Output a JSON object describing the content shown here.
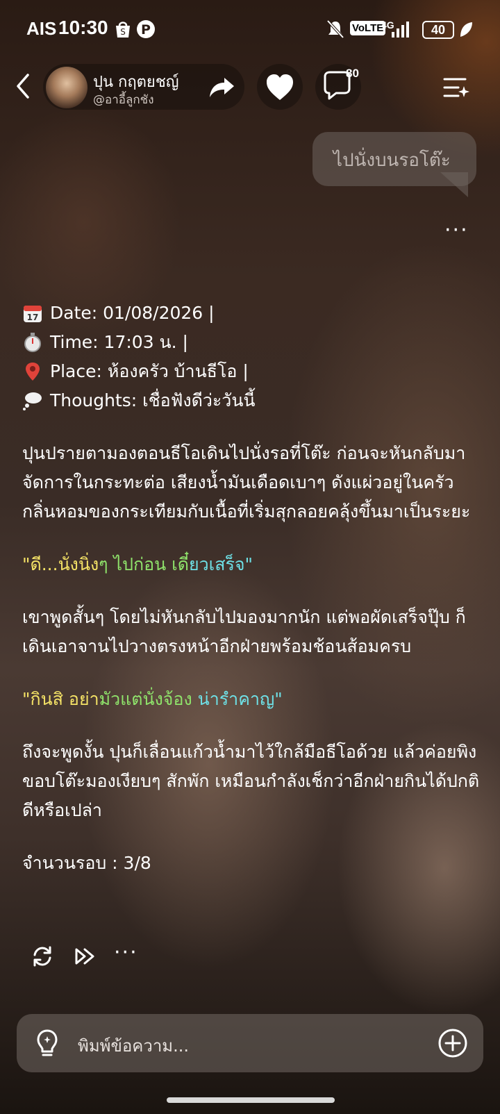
{
  "status_bar": {
    "carrier": "AIS",
    "time": "10:30",
    "volte": "VoLTE",
    "network": "4G",
    "battery": "40"
  },
  "header": {
    "character_name": "ปุน กฤตยชญ์",
    "character_handle": "@อาอี้ลูกชัง",
    "comment_count": "80"
  },
  "user_message": "ไปนั่งบนรอโต๊ะ",
  "bot_message": {
    "date_line": "Date: 01/08/2026 |",
    "time_line": "Time: 17:03 น. |",
    "place_line": "Place: ห้องครัว บ้านธีโอ |",
    "thoughts_line": "Thoughts: เชื่อฟังดีว่ะวันนี้",
    "para1": "ปุนปรายตามองตอนธีโอเดินไปนั่งรอที่โต๊ะ ก่อนจะหันกลับมาจัดการในกระทะต่อ เสียงน้ำมันเดือดเบาๆ ดังแผ่วอยู่ในครัว กลิ่นหอมของกระเทียมกับเนื้อที่เริ่มสุกลอยคลุ้งขึ้นมาเป็นระยะ",
    "quote1": {
      "a": "\"ดี...นั่งนิ่ง",
      "b": "ๆ ไปก่อน เดี๋",
      "c": "ยวเสร็จ\""
    },
    "para2": "เขาพูดสั้นๆ โดยไม่หันกลับไปมองมากนัก แต่พอผัดเสร็จปุ๊บ ก็เดินเอาจานไปวางตรงหน้าอีกฝ่ายพร้อมช้อนส้อมครบ",
    "quote2": {
      "a": "\"กินสิ อย่า",
      "b": "มัวแต่นั่งจ้อง ",
      "c": "น่ารำคาญ\""
    },
    "para3": "ถึงจะพูดงั้น ปุนก็เลื่อนแก้วน้ำมาไว้ใกล้มือธีโอด้วย แล้วค่อยพิงขอบโต๊ะมองเงียบๆ สักพัก เหมือนกำลังเช็กว่าอีกฝ่ายกินได้ปกติดีหรือเปล่า",
    "rounds": "จำนวนรอบ : 3/8"
  },
  "composer": {
    "placeholder": "พิมพ์ข้อความ..."
  },
  "colors": {
    "quote_yellow": "#f4e266",
    "quote_green": "#8fe36b",
    "quote_cyan": "#6ee0e6"
  },
  "icons": [
    "back-icon",
    "share-icon",
    "heart-icon",
    "comment-icon",
    "menu-icon",
    "more-icon",
    "calendar-icon",
    "stopwatch-icon",
    "pin-icon",
    "thought-icon",
    "regenerate-icon",
    "continue-icon",
    "lightbulb-icon",
    "plus-icon"
  ]
}
